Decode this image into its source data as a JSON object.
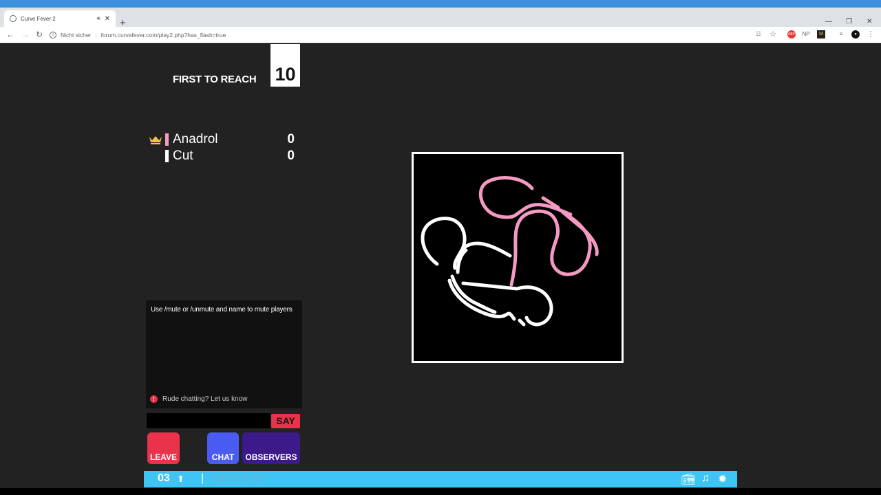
{
  "browser": {
    "tab_title": "Curve Fever 2",
    "security_label": "Nicht sicher",
    "url": "forum.curvefever.com/play2.php?has_flash=true",
    "extensions": [
      "NP"
    ]
  },
  "game": {
    "first_to_reach_label": "FIRST TO REACH",
    "first_to_reach_value": "10",
    "players": [
      {
        "name": "Anadrol",
        "score": "0",
        "color": "#f49ac2",
        "leader": true
      },
      {
        "name": "Cut",
        "score": "0",
        "color": "#ffffff",
        "leader": false
      }
    ]
  },
  "chat": {
    "system_message": "Use /mute or /unmute and name to mute players",
    "report_text": "Rude chatting? Let us know",
    "say_label": "SAY"
  },
  "buttons": {
    "leave": "LEAVE",
    "chat": "CHAT",
    "observers": "OBSERVERS"
  },
  "footer": {
    "level": "03",
    "username": "KIROVETS"
  },
  "colors": {
    "background": "#222222",
    "leave": "#e8334a",
    "chat": "#4a5cf0",
    "observers": "#3d1a8a",
    "footer": "#3ec5f5",
    "crown": "#f2c14e"
  }
}
